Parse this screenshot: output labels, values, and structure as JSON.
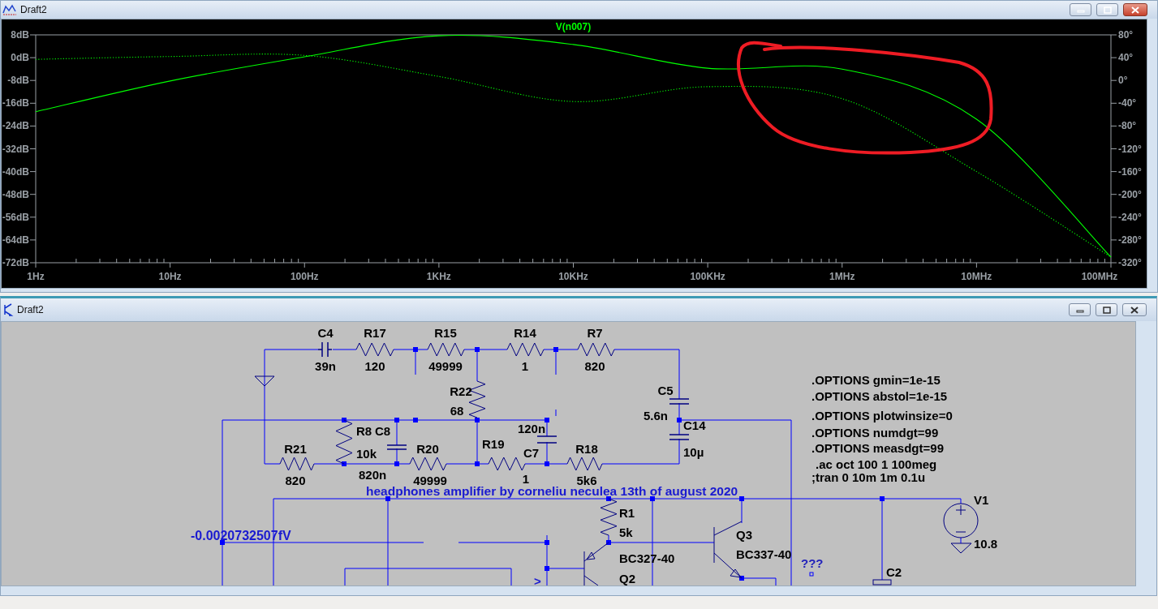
{
  "plot_window": {
    "title": "Draft2",
    "chart_data": {
      "type": "line",
      "title": "V(n007)",
      "categories": [
        "1Hz",
        "10Hz",
        "100Hz",
        "1KHz",
        "10KHz",
        "100KHz",
        "1MHz",
        "10MHz",
        "100MHz"
      ],
      "ylim": [
        -72,
        8
      ],
      "yticks": [
        {
          "value": 8,
          "label": "8dB"
        },
        {
          "value": 0,
          "label": "0dB"
        },
        {
          "value": -8,
          "label": "-8dB"
        },
        {
          "value": -16,
          "label": "-16dB"
        },
        {
          "value": -24,
          "label": "-24dB"
        },
        {
          "value": -32,
          "label": "-32dB"
        },
        {
          "value": -40,
          "label": "-40dB"
        },
        {
          "value": -48,
          "label": "-48dB"
        },
        {
          "value": -56,
          "label": "-56dB"
        },
        {
          "value": -64,
          "label": "-64dB"
        },
        {
          "value": -72,
          "label": "-72dB"
        }
      ],
      "y2lim": [
        -320,
        80
      ],
      "y2ticks": [
        {
          "value": 80,
          "label": "80°"
        },
        {
          "value": 40,
          "label": "40°"
        },
        {
          "value": 0,
          "label": "0°"
        },
        {
          "value": -40,
          "label": "-40°"
        },
        {
          "value": -80,
          "label": "-80°"
        },
        {
          "value": -120,
          "label": "-120°"
        },
        {
          "value": -160,
          "label": "-160°"
        },
        {
          "value": -200,
          "label": "-200°"
        },
        {
          "value": -240,
          "label": "-240°"
        },
        {
          "value": -280,
          "label": "-280°"
        },
        {
          "value": -320,
          "label": "-320°"
        }
      ],
      "series": [
        {
          "color": "#00ff00",
          "line_style": "solid",
          "values": [
            -19,
            -8.2,
            0.3,
            7.7,
            4.6,
            -3.7,
            -4,
            -21.6,
            -70
          ]
        },
        {
          "axis": "y2",
          "color": "#00ff00",
          "line_style": "dotted",
          "values": [
            37,
            42,
            44,
            7,
            -37,
            -11,
            -32,
            -160,
            -310
          ]
        }
      ]
    }
  },
  "schematic_window": {
    "title": "Draft2",
    "components": [
      {
        "kind": "capacitor",
        "name": "C4",
        "value": "39n"
      },
      {
        "kind": "resistor",
        "name": "R17",
        "value": "120"
      },
      {
        "kind": "resistor",
        "name": "R15",
        "value": "49999"
      },
      {
        "kind": "resistor",
        "name": "R14",
        "value": "1"
      },
      {
        "kind": "resistor",
        "name": "R7",
        "value": "820"
      },
      {
        "kind": "resistor",
        "name": "R22",
        "value": "68"
      },
      {
        "kind": "capacitor",
        "name": "C5",
        "value": "5.6n"
      },
      {
        "kind": "resistor",
        "name": "R8",
        "value": "10k"
      },
      {
        "kind": "capacitor",
        "name": "C8",
        "value": "820n"
      },
      {
        "kind": "capacitor",
        "name": "C7",
        "value": "120n"
      },
      {
        "kind": "capacitor",
        "name": "C14",
        "value": "10µ"
      },
      {
        "kind": "resistor",
        "name": "R21",
        "value": "820"
      },
      {
        "kind": "resistor",
        "name": "R20",
        "value": "49999"
      },
      {
        "kind": "resistor",
        "name": "R19",
        "value": "1"
      },
      {
        "kind": "resistor",
        "name": "R18",
        "value": "5k6"
      },
      {
        "kind": "resistor",
        "name": "R1",
        "value": "5k"
      },
      {
        "kind": "pnp",
        "name": "Q2",
        "value": "BC327-40"
      },
      {
        "kind": "npn",
        "name": "Q3",
        "value": "BC337-40"
      },
      {
        "kind": "voltage",
        "name": "V1",
        "value": "10.8"
      },
      {
        "kind": "capacitor_cut",
        "name": "C2"
      }
    ],
    "net_label": "-0.0020732507fV",
    "comment": "headphones amplifier by corneliu neculea 13th of august 2020",
    "directives": [
      ".OPTIONS gmin=1e-15",
      ".OPTIONS abstol=1e-15",
      ".OPTIONS plotwinsize=0",
      ".OPTIONS numdgt=99",
      ".OPTIONS measdgt=99",
      ".ac oct 100 1 100meg",
      ";tran 0 10m 1m 0.1u"
    ],
    "unknown_marker": "???",
    "partial_label": ">"
  }
}
